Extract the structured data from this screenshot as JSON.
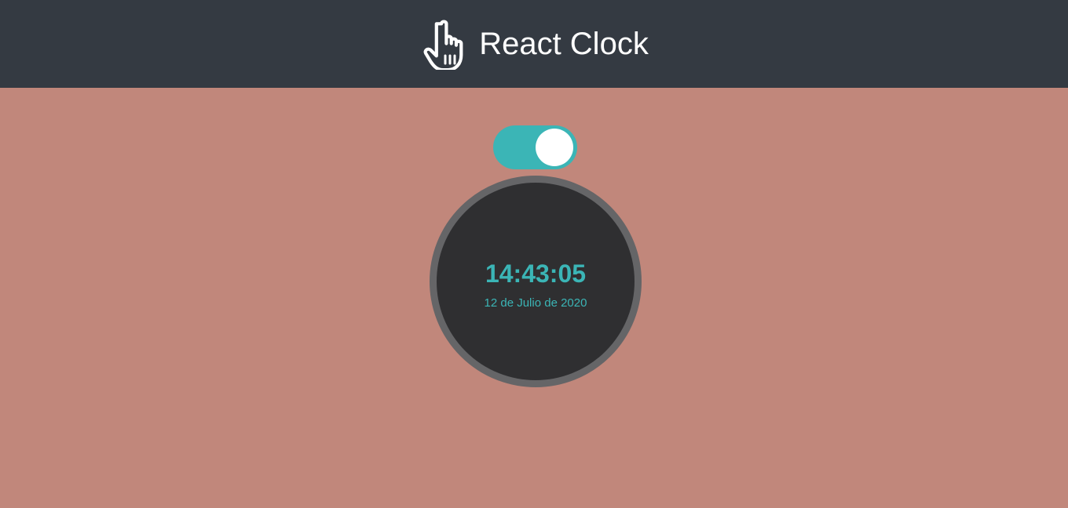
{
  "header": {
    "title": "React Clock",
    "icon": "pointing-hand-icon"
  },
  "toggle": {
    "state": "on",
    "color": "#3bb5b6"
  },
  "clock": {
    "time": "14:43:05",
    "date": "12 de Julio de 2020"
  },
  "colors": {
    "background": "#c1877b",
    "header": "#343a42",
    "accent": "#3bb5b6",
    "clock_face": "#2f2f31",
    "clock_ring": "#656567"
  }
}
